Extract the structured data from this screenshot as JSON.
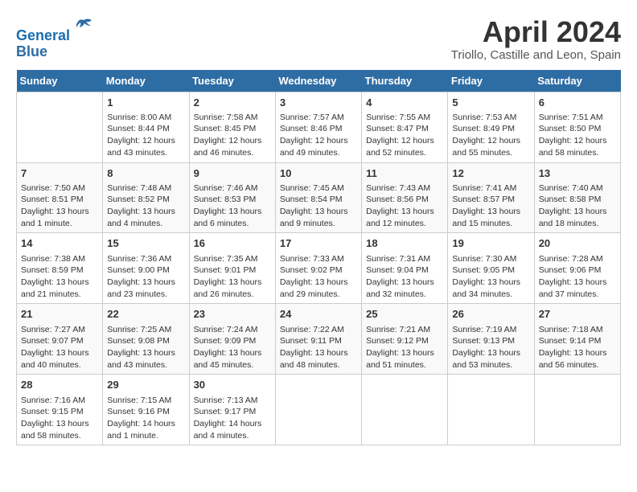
{
  "header": {
    "logo_line1": "General",
    "logo_line2": "Blue",
    "month_title": "April 2024",
    "subtitle": "Triollo, Castille and Leon, Spain"
  },
  "days_of_week": [
    "Sunday",
    "Monday",
    "Tuesday",
    "Wednesday",
    "Thursday",
    "Friday",
    "Saturday"
  ],
  "weeks": [
    [
      {
        "num": "",
        "text": ""
      },
      {
        "num": "1",
        "text": "Sunrise: 8:00 AM\nSunset: 8:44 PM\nDaylight: 12 hours\nand 43 minutes."
      },
      {
        "num": "2",
        "text": "Sunrise: 7:58 AM\nSunset: 8:45 PM\nDaylight: 12 hours\nand 46 minutes."
      },
      {
        "num": "3",
        "text": "Sunrise: 7:57 AM\nSunset: 8:46 PM\nDaylight: 12 hours\nand 49 minutes."
      },
      {
        "num": "4",
        "text": "Sunrise: 7:55 AM\nSunset: 8:47 PM\nDaylight: 12 hours\nand 52 minutes."
      },
      {
        "num": "5",
        "text": "Sunrise: 7:53 AM\nSunset: 8:49 PM\nDaylight: 12 hours\nand 55 minutes."
      },
      {
        "num": "6",
        "text": "Sunrise: 7:51 AM\nSunset: 8:50 PM\nDaylight: 12 hours\nand 58 minutes."
      }
    ],
    [
      {
        "num": "7",
        "text": "Sunrise: 7:50 AM\nSunset: 8:51 PM\nDaylight: 13 hours\nand 1 minute."
      },
      {
        "num": "8",
        "text": "Sunrise: 7:48 AM\nSunset: 8:52 PM\nDaylight: 13 hours\nand 4 minutes."
      },
      {
        "num": "9",
        "text": "Sunrise: 7:46 AM\nSunset: 8:53 PM\nDaylight: 13 hours\nand 6 minutes."
      },
      {
        "num": "10",
        "text": "Sunrise: 7:45 AM\nSunset: 8:54 PM\nDaylight: 13 hours\nand 9 minutes."
      },
      {
        "num": "11",
        "text": "Sunrise: 7:43 AM\nSunset: 8:56 PM\nDaylight: 13 hours\nand 12 minutes."
      },
      {
        "num": "12",
        "text": "Sunrise: 7:41 AM\nSunset: 8:57 PM\nDaylight: 13 hours\nand 15 minutes."
      },
      {
        "num": "13",
        "text": "Sunrise: 7:40 AM\nSunset: 8:58 PM\nDaylight: 13 hours\nand 18 minutes."
      }
    ],
    [
      {
        "num": "14",
        "text": "Sunrise: 7:38 AM\nSunset: 8:59 PM\nDaylight: 13 hours\nand 21 minutes."
      },
      {
        "num": "15",
        "text": "Sunrise: 7:36 AM\nSunset: 9:00 PM\nDaylight: 13 hours\nand 23 minutes."
      },
      {
        "num": "16",
        "text": "Sunrise: 7:35 AM\nSunset: 9:01 PM\nDaylight: 13 hours\nand 26 minutes."
      },
      {
        "num": "17",
        "text": "Sunrise: 7:33 AM\nSunset: 9:02 PM\nDaylight: 13 hours\nand 29 minutes."
      },
      {
        "num": "18",
        "text": "Sunrise: 7:31 AM\nSunset: 9:04 PM\nDaylight: 13 hours\nand 32 minutes."
      },
      {
        "num": "19",
        "text": "Sunrise: 7:30 AM\nSunset: 9:05 PM\nDaylight: 13 hours\nand 34 minutes."
      },
      {
        "num": "20",
        "text": "Sunrise: 7:28 AM\nSunset: 9:06 PM\nDaylight: 13 hours\nand 37 minutes."
      }
    ],
    [
      {
        "num": "21",
        "text": "Sunrise: 7:27 AM\nSunset: 9:07 PM\nDaylight: 13 hours\nand 40 minutes."
      },
      {
        "num": "22",
        "text": "Sunrise: 7:25 AM\nSunset: 9:08 PM\nDaylight: 13 hours\nand 43 minutes."
      },
      {
        "num": "23",
        "text": "Sunrise: 7:24 AM\nSunset: 9:09 PM\nDaylight: 13 hours\nand 45 minutes."
      },
      {
        "num": "24",
        "text": "Sunrise: 7:22 AM\nSunset: 9:11 PM\nDaylight: 13 hours\nand 48 minutes."
      },
      {
        "num": "25",
        "text": "Sunrise: 7:21 AM\nSunset: 9:12 PM\nDaylight: 13 hours\nand 51 minutes."
      },
      {
        "num": "26",
        "text": "Sunrise: 7:19 AM\nSunset: 9:13 PM\nDaylight: 13 hours\nand 53 minutes."
      },
      {
        "num": "27",
        "text": "Sunrise: 7:18 AM\nSunset: 9:14 PM\nDaylight: 13 hours\nand 56 minutes."
      }
    ],
    [
      {
        "num": "28",
        "text": "Sunrise: 7:16 AM\nSunset: 9:15 PM\nDaylight: 13 hours\nand 58 minutes."
      },
      {
        "num": "29",
        "text": "Sunrise: 7:15 AM\nSunset: 9:16 PM\nDaylight: 14 hours\nand 1 minute."
      },
      {
        "num": "30",
        "text": "Sunrise: 7:13 AM\nSunset: 9:17 PM\nDaylight: 14 hours\nand 4 minutes."
      },
      {
        "num": "",
        "text": ""
      },
      {
        "num": "",
        "text": ""
      },
      {
        "num": "",
        "text": ""
      },
      {
        "num": "",
        "text": ""
      }
    ]
  ]
}
